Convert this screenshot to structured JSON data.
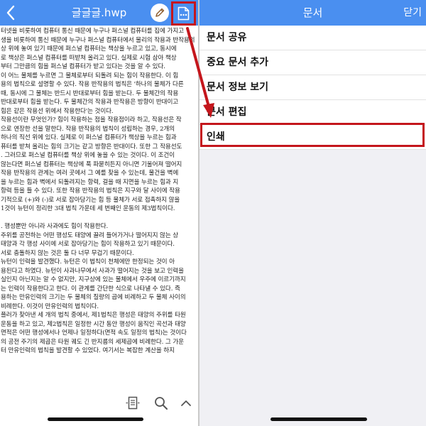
{
  "viewer": {
    "title": "글글글.hwp",
    "back_icon": "chevron-left-icon",
    "edit_icon": "pen-icon",
    "more_icon": "document-more-icon",
    "lines": [
      "터넷을 비롯하여 컴퓨터 통신 때문에 누구나 퍼스널 컴퓨터를 집에 가지고",
      "생을 비롯하여 통신 때문에 누구나 퍼스널 컴퓨터에서 물리의 작용과 반작용의",
      "상 위에 놓여 있기 때문에 퍼스널 컴퓨터는 책상을 누르고 있고, 동시에",
      "로 책상은 퍼스널 컴퓨터를 떠받쳐 올리고 있다. 실제로 시험 삼아 책상",
      "부터 그만큼의 힘을 퍼스널 컴퓨터가 받고 있다는 것을 알 수 있다.",
      "이 어느 물체를 누르면 그 물체로부터 되돌려 되는 힘이 작용한다. 이 힘",
      "용의 법칙으로 설명할 수 있다. 작용 반작용의 법칙은 '하나의 물체가 다른",
      "때, 동시에 그 물체는 반드시 반대로부터 힘을 받는다. 두 물체간의 작용",
      "반대로부터 힘을 받는다. 두 물체간의 작용과 반작용은 방향이 반대이고",
      "힘은 같은 작용선 위에서 작용한다'는 것이다.",
      "작용선이란 무엇인가? 힘이 작용하는 점을 작용점이라 하고, 작용선은 작",
      "으로 연장한 선을 말한다. 작용 반작용의 법칙이 성립하는 경우, 2개의",
      "하나의 직선 위에 있다. 실제로 이 퍼스널 컴퓨터가 책상을 누르는 힘과",
      "퓨터를 받쳐 올리는 힘의 크기는 같고 방향은 반대이다. 또한 그 작용선도",
      ". 그러므로 퍼스널 컴퓨터를 책상 위에 놓을 수 있는 것이다. 이 조건이",
      "않는다면 퍼스널 컴퓨터는 책상에 푹 파묻히든지 아니면 기울어져 떨어지",
      "작용 반작용의 관계는 여러 곳에서 그 예를 찾을 수 있는데, 물건을 벽에",
      "을 누르는 힘과 벽에서 되돌려지는 항력, 걸을 때 지면을 누르는 힘과 지",
      "항력 등을 들 수 있다. 또한 작용 반작용의 법칙은 지구와 달 사이에 작용",
      "기적으로 (+)와 (-)로 서로 잡아당기는 힘 등 물체가 서로 접촉하지 않을",
      "1것이 뉴턴이 정리한 3대 법칙 가운데 세 번째인 운동의 제3법칙이다.",
      "",
      ". 행성뿐만 아니라 사과에도 힘이 작용한다.",
      "주위를 공전하는 어떤 행성도 태양에 끌려 들어가거나 떨어지지 않는 상",
      "태양과 각 행성 사이에 서로 잡아당기는 힘이 작용하고 있기 때문이다.",
      "서로 충돌하지 않는 것은 둘 다 너무 무겁기 때문이다.",
      "뉴턴이 인력을 발견했다. 뉴턴은 이 법칙이 천체에만 한정되는 것이 아",
      "용된다고 하였다. 뉴턴이 사과나무에서 사과가 떨어지는 것을 보고 인력을",
      "실인지 아닌지는 알 수 없지만, 지구상에 있는 물체에서 우주에 이르기까지",
      "는 인력이 작용한다고 한다. 이 관계를 간단한 식으로 나타낼 수 있다. 즉",
      "용하는 만유인력의 크기는 두 물체의 질량의 곱에 비례하고 두 물체 사이의",
      "비례한다. 이것이 만유인력의 법칙이다.",
      "플러가 찾아낸 세 개의 법칙 중에서, 제1법칙은 행성은 태양의 주위를 타원",
      "운동을 하고 있고, 제2법칙은 일정한 시간 동안 행성이 움직인 곡선과 태양",
      "면적은 어떤 행성에서나 언제나 일정하다(면적 속도 일정의 법칙)는 것이다",
      "의 공전 주기의 제곱은 타원 궤도 긴 반지름의 세제곱에 비례한다. 그 가운",
      "터 만유인력의 법칙을 발견할 수 있었다. 여기서는 복잡한 계산을 하지"
    ],
    "bottom_icons": [
      "page-view-icon",
      "search-icon",
      "chevron-up-icon"
    ]
  },
  "menu": {
    "title": "문서",
    "close_label": "닫기",
    "items": [
      {
        "label": "문서 공유"
      },
      {
        "label": "중요 문서 추가"
      },
      {
        "label": "문서 정보 보기"
      },
      {
        "label": "문서 편집"
      },
      {
        "label": "인쇄"
      }
    ]
  },
  "annotations": {
    "highlight_color": "#c4161c",
    "arrow_color": "#c4161c",
    "header_color": "#4a8ff0"
  }
}
